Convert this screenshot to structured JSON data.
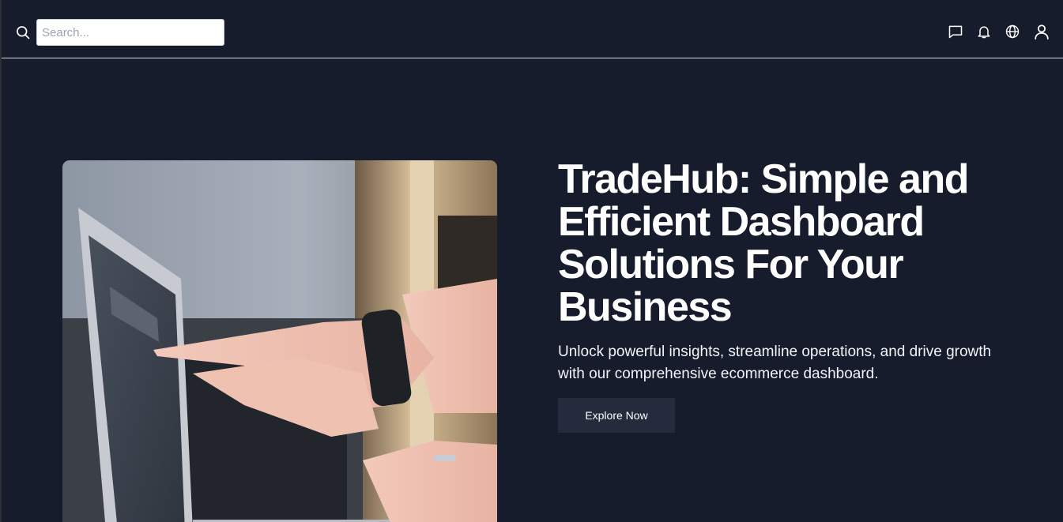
{
  "header": {
    "search": {
      "placeholder": "Search..."
    },
    "icons": [
      "message-icon",
      "bell-icon",
      "globe-icon",
      "user-icon"
    ]
  },
  "hero": {
    "title": "TradeHub: Simple and Efficient Dashboard Solutions For Your Business",
    "subtitle": "Unlock powerful insights, streamline operations, and drive growth with our comprehensive ecommerce dashboard.",
    "cta_label": "Explore Now"
  },
  "colors": {
    "background": "#171c2c",
    "button": "#242b3d",
    "text": "#ffffff"
  }
}
